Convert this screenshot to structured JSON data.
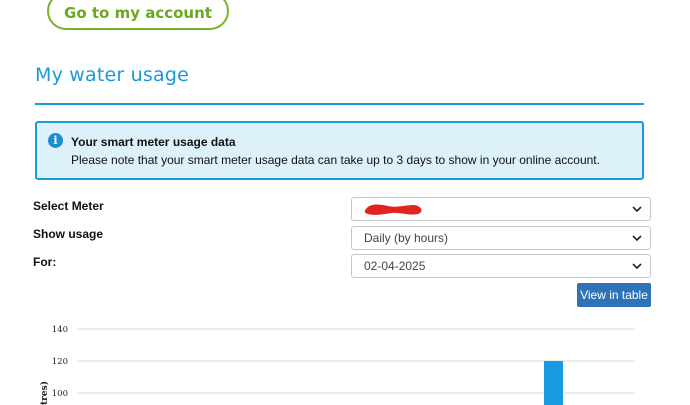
{
  "header": {
    "account_button": "Go to my account"
  },
  "page": {
    "title": "My water usage"
  },
  "info": {
    "icon": "info-icon",
    "title": "Your smart meter usage data",
    "text": "Please note that your smart meter usage data can take up to 3 days to show in your online account."
  },
  "form": {
    "meter_label": "Select Meter",
    "meter_value": "",
    "usage_label": "Show usage",
    "usage_value": "Daily (by hours)",
    "for_label": "For:",
    "for_value": "02-04-2025",
    "view_table_button": "View in table"
  },
  "colors": {
    "brand_blue": "#1a9ad6",
    "green_button": "#78b428",
    "bar": "#169be0",
    "table_button": "#2e73b8"
  },
  "chart_data": {
    "type": "bar",
    "ylabel": "tres)",
    "y_ticks": [
      "140",
      "120",
      "100"
    ],
    "ylim_visible": [
      100,
      140
    ],
    "values": [
      120
    ],
    "grid": true
  }
}
